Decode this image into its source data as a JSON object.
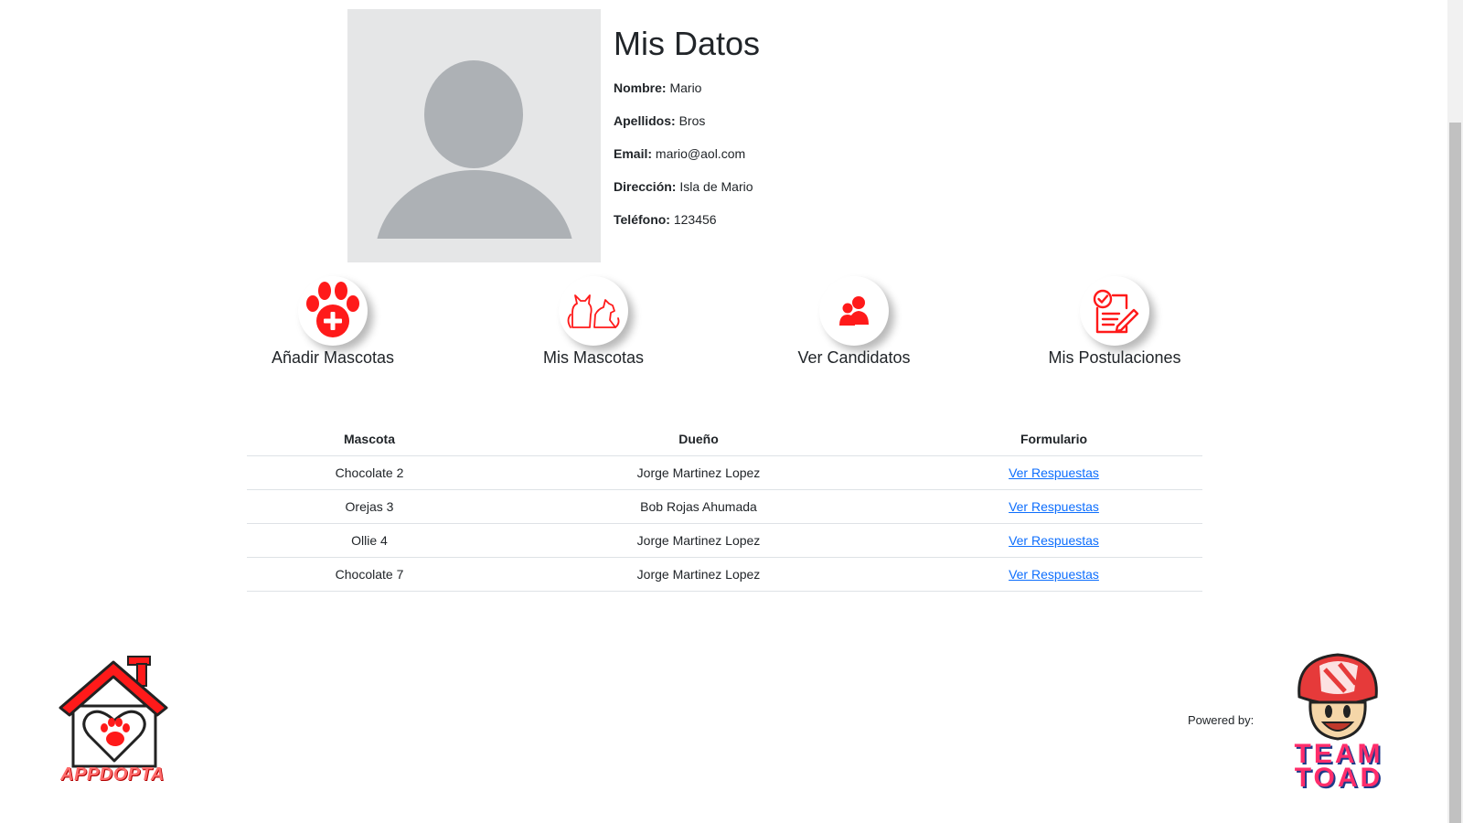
{
  "profile": {
    "title": "Mis Datos",
    "fields": [
      {
        "label": "Nombre:",
        "value": "Mario"
      },
      {
        "label": "Apellidos:",
        "value": "Bros"
      },
      {
        "label": "Email:",
        "value": "mario@aol.com"
      },
      {
        "label": "Dirección:",
        "value": "Isla de Mario"
      },
      {
        "label": "Teléfono:",
        "value": "123456"
      }
    ]
  },
  "actions": [
    {
      "label": "Añadir Mascotas",
      "icon": "paw-plus-icon"
    },
    {
      "label": "Mis Mascotas",
      "icon": "cat-dog-icon"
    },
    {
      "label": "Ver Candidatos",
      "icon": "users-icon"
    },
    {
      "label": "Mis Postulaciones",
      "icon": "checklist-edit-icon"
    }
  ],
  "table": {
    "headers": [
      "Mascota",
      "Dueño",
      "Formulario"
    ],
    "rows": [
      {
        "mascota": "Chocolate 2",
        "dueno": "Jorge Martinez Lopez",
        "formulario": "Ver Respuestas"
      },
      {
        "mascota": "Orejas 3",
        "dueno": "Bob Rojas Ahumada",
        "formulario": "Ver Respuestas"
      },
      {
        "mascota": "Ollie 4",
        "dueno": "Jorge Martinez Lopez",
        "formulario": "Ver Respuestas"
      },
      {
        "mascota": "Chocolate 7",
        "dueno": "Jorge Martinez Lopez",
        "formulario": "Ver Respuestas"
      }
    ]
  },
  "footer": {
    "logo_text": "APPDOPTA",
    "powered_label": "Powered by:",
    "team_line1": "TEAM",
    "team_line2": "TOAD"
  },
  "colors": {
    "accent": "#ff1a1a",
    "link": "#0d6efd",
    "avatar_bg": "#e5e6e7",
    "avatar_fg": "#adb1b5"
  }
}
